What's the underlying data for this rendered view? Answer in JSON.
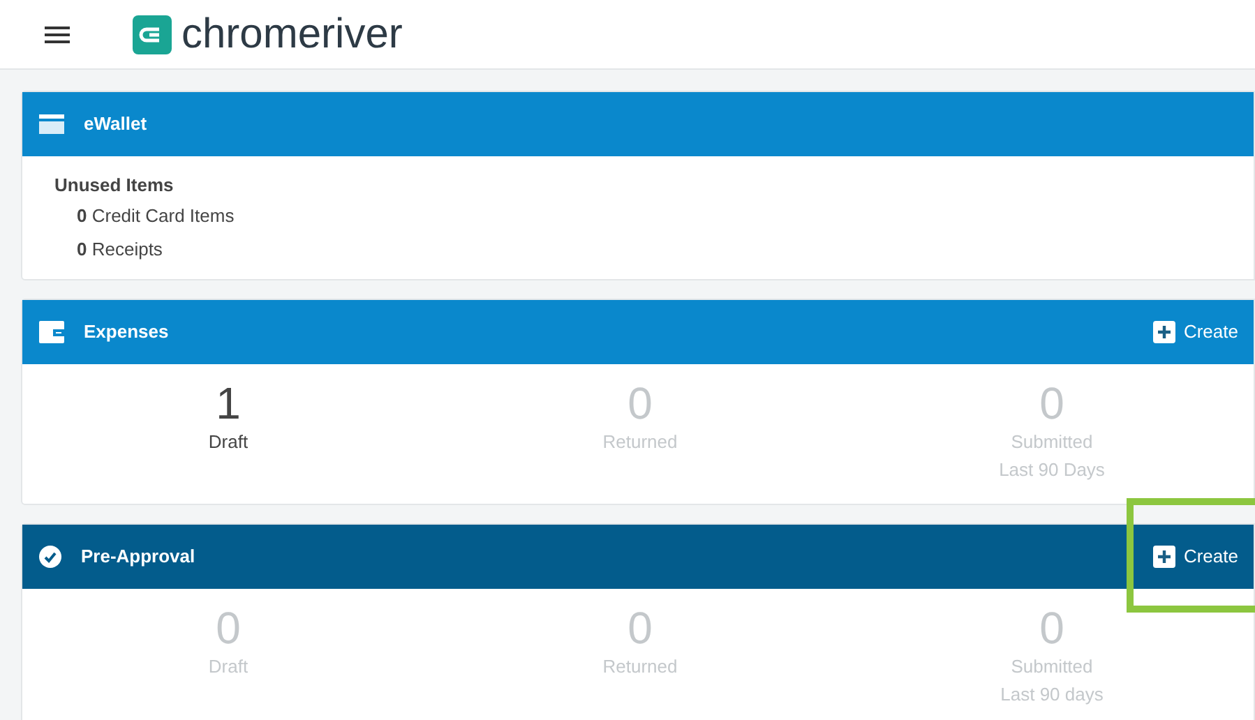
{
  "header": {
    "logo_text": "chromeriver"
  },
  "ewallet": {
    "title": "eWallet",
    "section": "Unused Items",
    "items": [
      {
        "count": "0",
        "label": "Credit Card Items"
      },
      {
        "count": "0",
        "label": "Receipts"
      }
    ]
  },
  "panels": [
    {
      "title": "Expenses",
      "kind": "expenses",
      "create": {
        "label": "Create",
        "highlighted": false
      },
      "stats": [
        {
          "value": "1",
          "label": "Draft",
          "active": true
        },
        {
          "value": "0",
          "label": "Returned",
          "active": false
        },
        {
          "value": "0",
          "label": "Submitted",
          "sublabel": "Last 90 Days",
          "active": false
        }
      ]
    },
    {
      "title": "Pre-Approval",
      "kind": "preapproval",
      "create": {
        "label": "Create",
        "highlighted": true
      },
      "stats": [
        {
          "value": "0",
          "label": "Draft",
          "active": false
        },
        {
          "value": "0",
          "label": "Returned",
          "active": false
        },
        {
          "value": "0",
          "label": "Submitted",
          "sublabel": "Last 90 days",
          "active": false
        }
      ]
    }
  ]
}
